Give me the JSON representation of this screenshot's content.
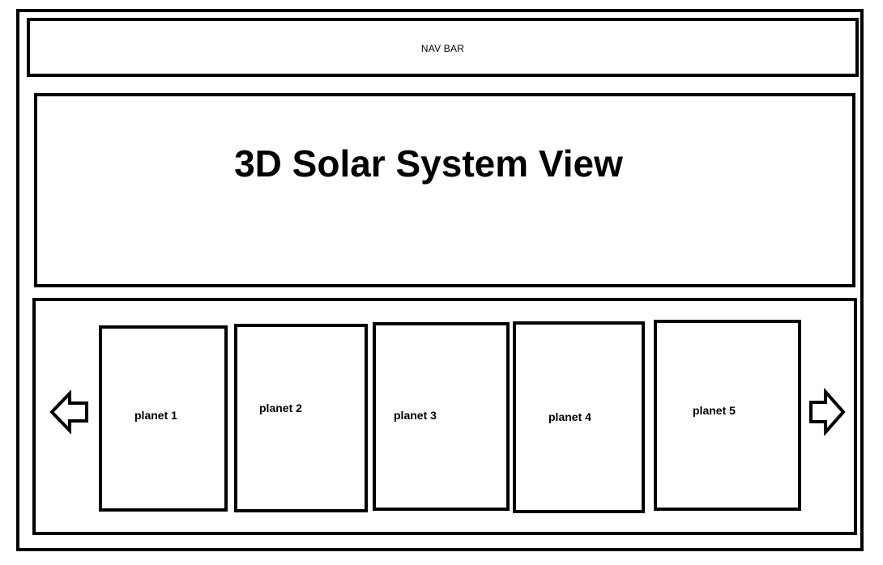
{
  "nav": {
    "label": "NAV BAR"
  },
  "viewport": {
    "title": "3D Solar System View"
  },
  "carousel": {
    "prev_icon": "left-arrow-icon",
    "next_icon": "right-arrow-icon",
    "planets": [
      {
        "label": "planet 1"
      },
      {
        "label": "planet 2"
      },
      {
        "label": "planet 3"
      },
      {
        "label": "planet 4"
      },
      {
        "label": "planet 5"
      }
    ]
  }
}
